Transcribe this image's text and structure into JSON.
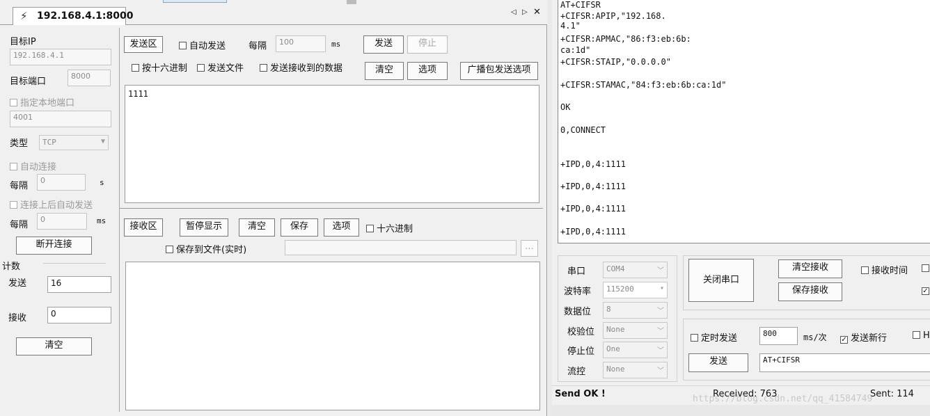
{
  "tab": {
    "title": "192.168.4.1:8000",
    "nav_prev": "◁",
    "nav_next": "▷",
    "close": "✕"
  },
  "left": {
    "target_ip_label": "目标IP",
    "target_ip_value": "192.168.4.1",
    "target_port_label": "目标端口",
    "target_port_value": "8000",
    "local_port_label": "指定本地端口",
    "local_port_value": "4001",
    "type_label": "类型",
    "type_value": "TCP",
    "auto_connect_label": "自动连接",
    "interval_label": "每隔",
    "interval_value": "0",
    "interval_unit": "s",
    "auto_send_after_connect_label": "连接上后自动发送",
    "interval2_label": "每隔",
    "interval2_value": "0",
    "interval2_unit": "ms",
    "disconnect_button": "断开连接",
    "count_title": "计数",
    "sent_label": "发送",
    "sent_value": "16",
    "recv_label": "接收",
    "recv_value": "0",
    "clear_button": "清空"
  },
  "send": {
    "area_label": "发送区",
    "auto_send_label": "自动发送",
    "every_label": "每隔",
    "every_value": "100",
    "every_unit": "ms",
    "send_button": "发送",
    "stop_button": "停止",
    "hex_label": "按十六进制",
    "send_file_label": "发送文件",
    "send_recv_label": "发送接收到的数据",
    "clear_button": "清空",
    "options_button": "选项",
    "broadcast_button": "广播包发送选项",
    "content": "1111"
  },
  "recv": {
    "area_label": "接收区",
    "pause_button": "暂停显示",
    "clear_button": "清空",
    "save_button": "保存",
    "options_button": "选项",
    "hex_label": "十六进制",
    "save_to_file_label": "保存到文件(实时)",
    "browse_button": "..."
  },
  "terminal": {
    "lines": [
      "AT+CIFSR",
      "+CIFSR:APIP,\"192.168.",
      "4.1\"",
      "+CIFSR:APMAC,\"86:f3:eb:6b:",
      "ca:1d\"",
      "+CIFSR:STAIP,\"0.0.0.0\"",
      "+CIFSR:STAMAC,\"84:f3:eb:6b:ca:1d\"",
      "OK",
      "0,CONNECT",
      "+IPD,0,4:1111",
      "+IPD,0,4:1111",
      "+IPD,0,4:1111",
      "+IPD,0,4:1111"
    ]
  },
  "serial": {
    "port_label": "串口",
    "port_value": "COM4",
    "baud_label": "波特率",
    "baud_value": "115200",
    "databits_label": "数据位",
    "databits_value": "8",
    "parity_label": "校验位",
    "parity_value": "None",
    "stopbits_label": "停止位",
    "stopbits_value": "One",
    "flow_label": "流控",
    "flow_value": "None",
    "close_port_button": "关闭串口",
    "clear_recv_button": "清空接收",
    "save_recv_button": "保存接收",
    "recv_time_label": "接收时间",
    "timed_send_label": "定时发送",
    "timed_value": "800",
    "timed_unit": "ms/次",
    "newline_label": "发送新行",
    "send_button": "发送",
    "send_input": "AT+CIFSR",
    "partial_label": "H"
  },
  "status": {
    "send_ok": "Send OK !",
    "received": "Received: 763",
    "sent": "Sent: 114"
  },
  "watermark": "https://blog.csdn.net/qq_41584749"
}
